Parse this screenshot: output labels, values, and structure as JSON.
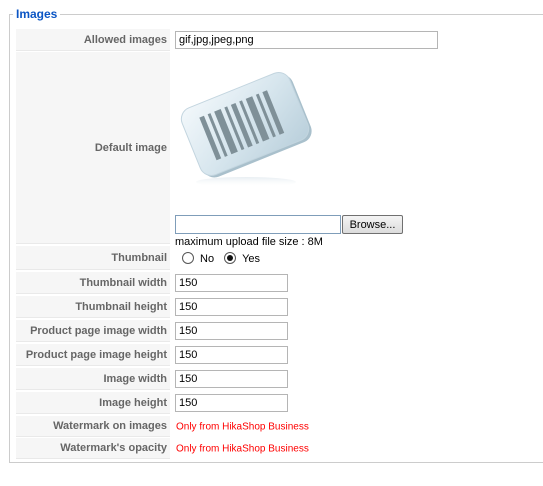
{
  "legend": "Images",
  "rows": {
    "allowed_images": {
      "label": "Allowed images",
      "value": "gif,jpg,jpeg,png"
    },
    "default_image": {
      "label": "Default image",
      "image_icon": "barcode-icon",
      "browse_label": "Browse...",
      "upload_note": "maximum upload file size : 8M"
    },
    "thumbnail": {
      "label": "Thumbnail",
      "option_no": "No",
      "option_yes": "Yes",
      "selected": "Yes"
    },
    "thumbnail_width": {
      "label": "Thumbnail width",
      "value": "150"
    },
    "thumbnail_height": {
      "label": "Thumbnail height",
      "value": "150"
    },
    "product_page_image_width": {
      "label": "Product page image width",
      "value": "150"
    },
    "product_page_image_height": {
      "label": "Product page image height",
      "value": "150"
    },
    "image_width": {
      "label": "Image width",
      "value": "150"
    },
    "image_height": {
      "label": "Image height",
      "value": "150"
    },
    "watermark_on_images": {
      "label": "Watermark on images",
      "note": "Only from HikaShop Business"
    },
    "watermark_opacity": {
      "label": "Watermark's opacity",
      "note": "Only from HikaShop Business"
    }
  },
  "colors": {
    "legend": "#0b55c4",
    "label_bg": "#f6f6f6",
    "label_text": "#666666",
    "note": "#ff0000"
  }
}
